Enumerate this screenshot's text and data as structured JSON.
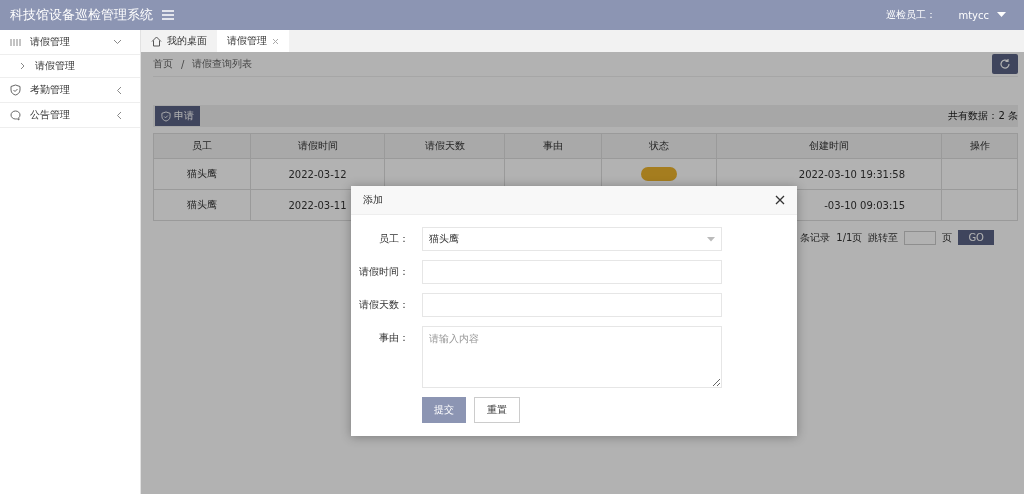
{
  "header": {
    "title": "科技馆设备巡检管理系统",
    "user_label": "巡检员工：",
    "user_name": "mtycc"
  },
  "sidebar": {
    "items": [
      {
        "label": "请假管理",
        "kind": "grid",
        "expanded": true,
        "children": [
          {
            "label": "请假管理"
          }
        ]
      },
      {
        "label": "考勤管理",
        "kind": "shield",
        "expanded": false
      },
      {
        "label": "公告管理",
        "kind": "bubble",
        "expanded": false
      }
    ]
  },
  "tabs": [
    {
      "label": "我的桌面",
      "kind": "home",
      "selected": false
    },
    {
      "label": "请假管理",
      "kind": "closable",
      "selected": true
    }
  ],
  "breadcrumb": {
    "items": [
      "首页",
      "请假查询列表"
    ],
    "separator": "/"
  },
  "toolbar": {
    "apply_button": "申请",
    "total": "共有数据：2 条"
  },
  "table": {
    "columns": [
      "员工",
      "请假时间",
      "请假天数",
      "事由",
      "状态",
      "创建时间",
      "操作"
    ],
    "rows": [
      {
        "employee": "猫头鹰",
        "leave_time": "2022-03-12",
        "color": "#a57d1f",
        "created_time": "2022-03-10 19:31:58"
      },
      {
        "employee": "猫头鹰",
        "leave_time": "2022-03-11",
        "created_time": "-03-10 09:03:15"
      }
    ]
  },
  "pagination": {
    "records": "条记录",
    "pages": "1/1页",
    "jump_label": "跳转至",
    "page_unit": "页",
    "go": "GO"
  },
  "dialog": {
    "title": "添加",
    "fields": [
      {
        "label": "员工：",
        "kind": "select",
        "value": "猫头鹰"
      },
      {
        "label": "请假时间：",
        "kind": "input"
      },
      {
        "label": "请假天数：",
        "kind": "input"
      },
      {
        "label": "事由：",
        "kind": "textarea",
        "placeholder": "请输入内容"
      }
    ],
    "buttons": [
      {
        "label": "提交",
        "kind": "primary"
      },
      {
        "label": "重置",
        "kind": "plain"
      }
    ]
  }
}
